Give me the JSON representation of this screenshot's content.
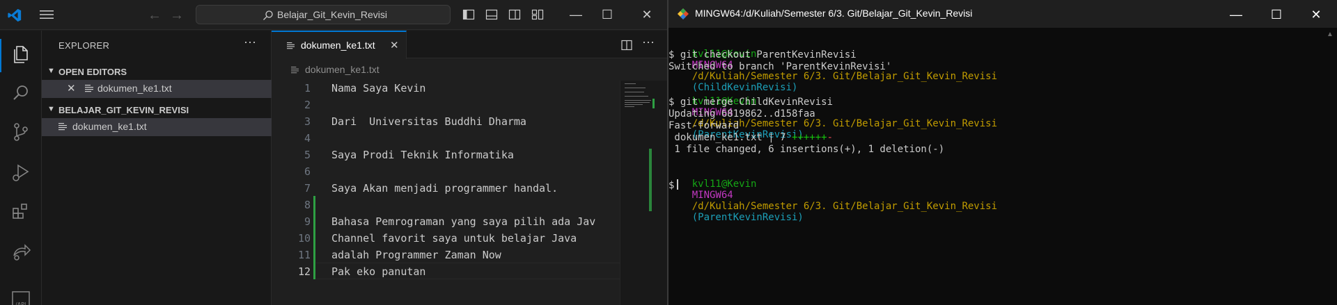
{
  "vscode": {
    "search": "Belajar_Git_Kevin_Revisi",
    "window_controls": [
      "—",
      "☐",
      "✕"
    ],
    "sidebar": {
      "title": "EXPLORER",
      "more": "···",
      "open_editors_label": "OPEN EDITORS",
      "open_editor_close": "✕",
      "open_editor_file": "dokumen_ke1.txt",
      "folder_label": "BELAJAR_GIT_KEVIN_REVISI",
      "folder_file": "dokumen_ke1.txt"
    },
    "editor": {
      "tab_label": "dokumen_ke1.txt",
      "tab_close": "✕",
      "more": "···",
      "breadcrumb": "dokumen_ke1.txt",
      "lines": [
        {
          "num": "1",
          "text": "Nama Saya Kevin"
        },
        {
          "num": "2",
          "text": ""
        },
        {
          "num": "3",
          "text": "Dari  Universitas Buddhi Dharma"
        },
        {
          "num": "4",
          "text": ""
        },
        {
          "num": "5",
          "text": "Saya Prodi Teknik Informatika"
        },
        {
          "num": "6",
          "text": ""
        },
        {
          "num": "7",
          "text": "Saya Akan menjadi programmer handal."
        },
        {
          "num": "8",
          "text": ""
        },
        {
          "num": "9",
          "text": "Bahasa Pemrograman yang saya pilih ada Jav"
        },
        {
          "num": "10",
          "text": "Channel favorit saya untuk belajar Java"
        },
        {
          "num": "11",
          "text": "adalah Programmer Zaman Now"
        },
        {
          "num": "12",
          "text": "Pak eko panutan"
        }
      ]
    }
  },
  "terminal": {
    "title": "MINGW64:/d/Kuliah/Semester 6/3. Git/Belajar_Git_Kevin_Revisi",
    "window_controls": [
      "—",
      "☐",
      "✕"
    ],
    "prompt_user": "kvl11@Kevin",
    "prompt_env": "MINGW64",
    "prompt_path": "/d/Kuliah/Semester 6/3. Git/Belajar_Git_Kevin_Revisi",
    "branch1": "(ChildKevinRevisi)",
    "cmd1": "$ git checkout ParentKevinRevisi",
    "out1": "Switched to branch 'ParentKevinRevisi'",
    "branch2": "(ParentKevinRevisi)",
    "cmd2": "$ git merge ChildKevinRevisi",
    "out2": "Updating 6819862..d158faa",
    "out3": "Fast-forward",
    "out4_file": " dokumen_ke1.txt | 7 ",
    "out4_plus": "++++++",
    "out4_minus": "-",
    "out5": " 1 file changed, 6 insertions(+), 1 deletion(-)",
    "branch3": "(ParentKevinRevisi)",
    "prompt_symbol": "$"
  },
  "colors": {
    "accent": "#0078d4",
    "git_added": "#2ea043",
    "prompt_green": "#15a715",
    "prompt_magenta": "#c238c2",
    "prompt_yellow": "#c19c00",
    "prompt_cyan": "#1c9fb8"
  },
  "icons": [
    "vscode-logo",
    "menu-icon",
    "search-icon",
    "files-icon",
    "search-activity-icon",
    "source-control-icon",
    "run-debug-icon",
    "extensions-icon",
    "remote-icon",
    "api-icon",
    "file-text-icon",
    "split-editor-icon",
    "git-bash-icon"
  ]
}
